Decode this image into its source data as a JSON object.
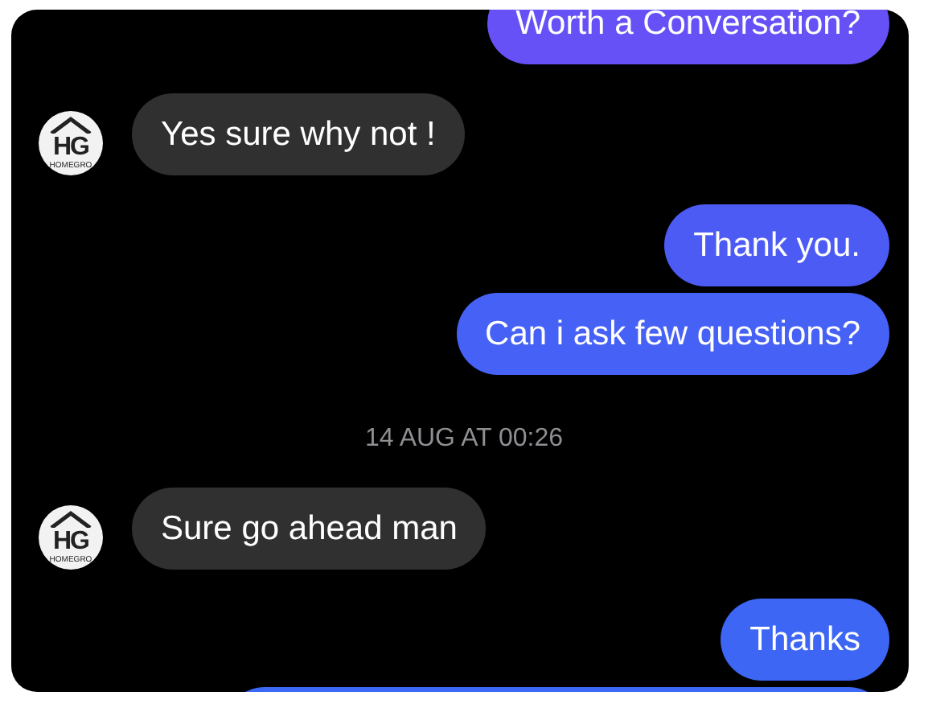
{
  "messages": [
    {
      "kind": "outgoing",
      "text": "Worth a Conversation?",
      "color": "#6651f7"
    },
    {
      "kind": "incoming",
      "text": "Yes sure why not !",
      "avatar": {
        "initials": "HG",
        "caption": "HOMEGRO"
      }
    },
    {
      "kind": "outgoing",
      "text": "Thank you.",
      "color": "#4d5bf5"
    },
    {
      "kind": "outgoing",
      "text": "Can i ask few questions?",
      "color": "#4661f5"
    },
    {
      "kind": "timestamp",
      "text": "14 AUG AT 00:26"
    },
    {
      "kind": "incoming",
      "text": "Sure go ahead man",
      "avatar": {
        "initials": "HG",
        "caption": "HOMEGRO"
      }
    },
    {
      "kind": "outgoing",
      "text": "Thanks",
      "color": "#3d66f5"
    },
    {
      "kind": "outgoing",
      "color": "#3b68f5"
    }
  ]
}
